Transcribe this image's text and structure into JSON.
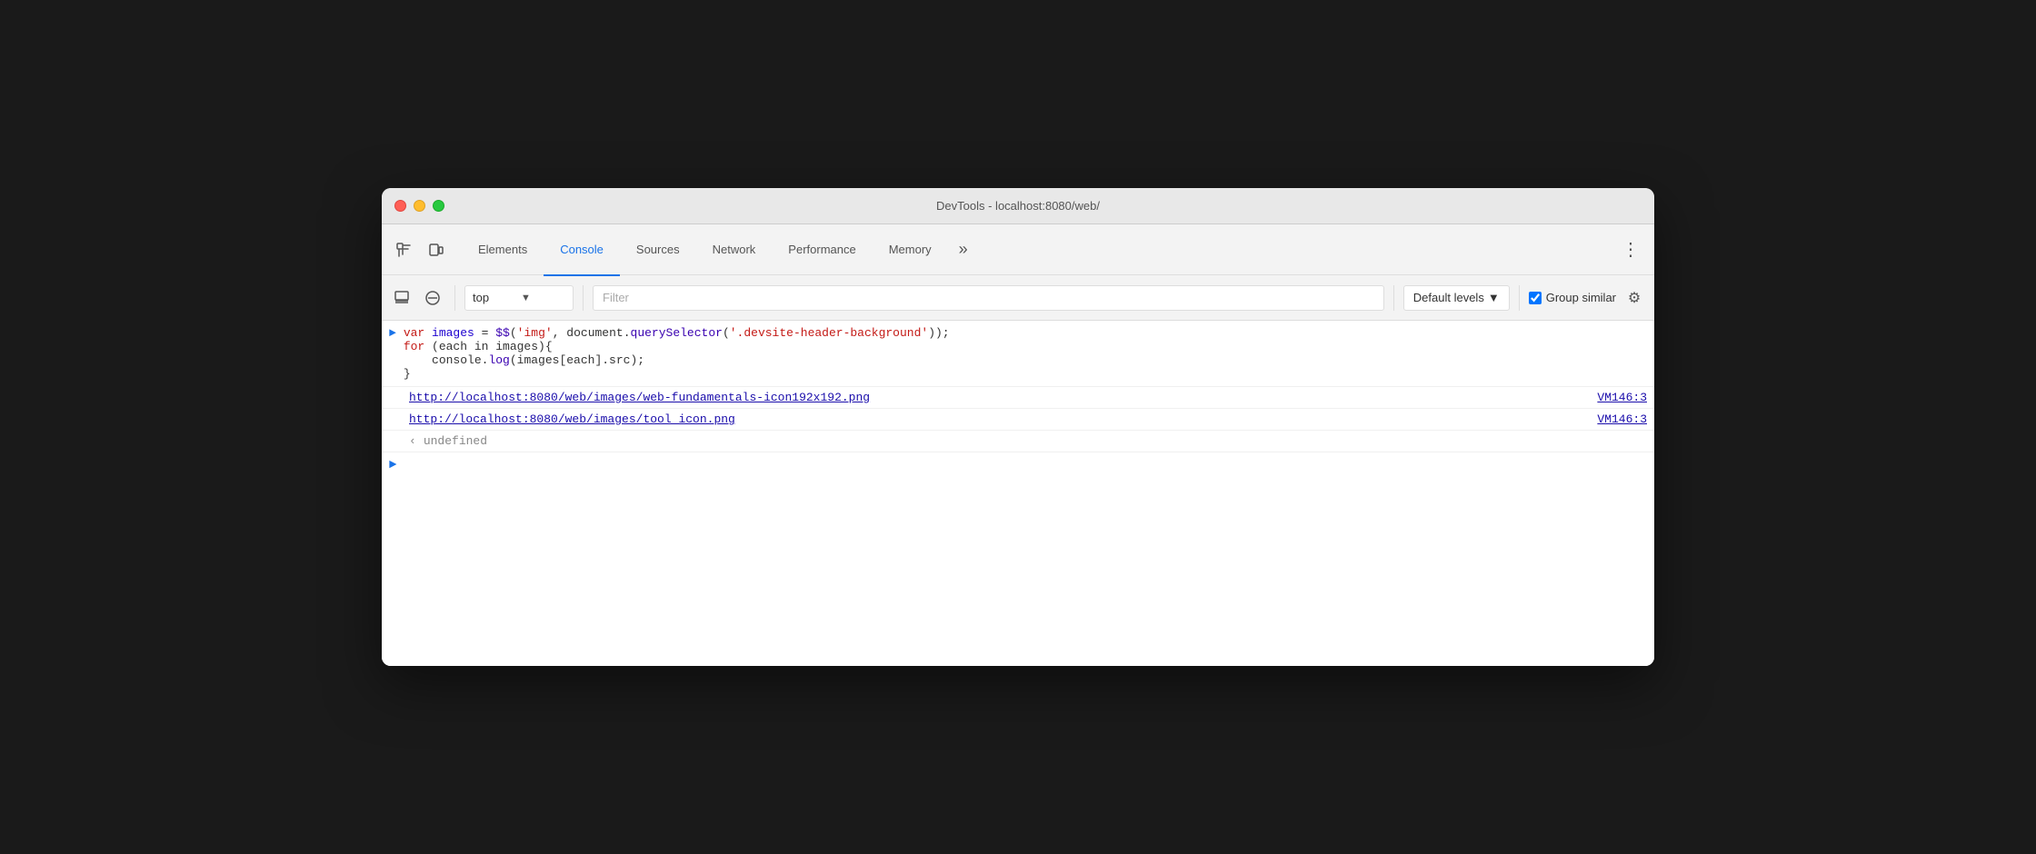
{
  "window": {
    "title": "DevTools - localhost:8080/web/"
  },
  "tabs": [
    {
      "id": "elements",
      "label": "Elements",
      "active": false
    },
    {
      "id": "console",
      "label": "Console",
      "active": true
    },
    {
      "id": "sources",
      "label": "Sources",
      "active": false
    },
    {
      "id": "network",
      "label": "Network",
      "active": false
    },
    {
      "id": "performance",
      "label": "Performance",
      "active": false
    },
    {
      "id": "memory",
      "label": "Memory",
      "active": false
    }
  ],
  "toolbar": {
    "context": "top",
    "filter_placeholder": "Filter",
    "levels_label": "Default levels",
    "group_similar_label": "Group similar"
  },
  "console": {
    "code_line": "var images = $$('img', document.querySelector('.devsite-header-background'));",
    "code_line2": "for (each in images){",
    "code_line3": "    console.log(images[each].src);",
    "code_line4": "}",
    "link1": "http://localhost:8080/web/images/web-fundamentals-icon192x192.png",
    "link1_vm": "VM146:3",
    "link2": "http://localhost:8080/web/images/tool_icon.png",
    "link2_vm": "VM146:3",
    "undefined_val": "undefined"
  }
}
